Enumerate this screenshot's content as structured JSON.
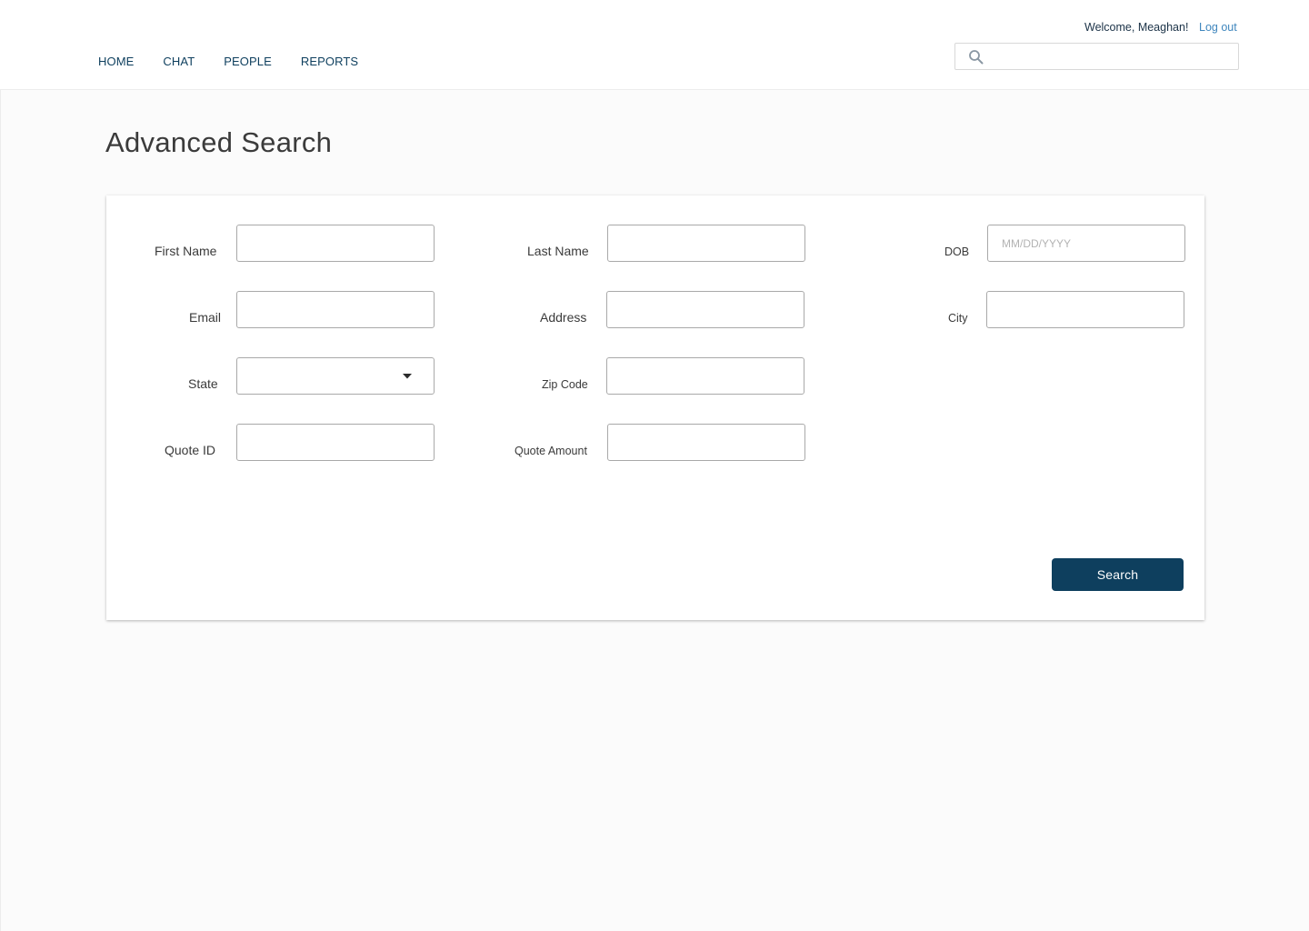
{
  "header": {
    "nav": [
      {
        "label": "HOME"
      },
      {
        "label": "CHAT"
      },
      {
        "label": "PEOPLE"
      },
      {
        "label": "REPORTS"
      }
    ],
    "welcome_text": "Welcome, Meaghan!",
    "logout_label": "Log out",
    "search": {
      "value": "",
      "placeholder": "",
      "icon": "search-icon"
    }
  },
  "page": {
    "title": "Advanced Search"
  },
  "form": {
    "first_name": {
      "label": "First Name",
      "value": ""
    },
    "last_name": {
      "label": "Last Name",
      "value": ""
    },
    "dob": {
      "label": "DOB",
      "value": "",
      "placeholder": "MM/DD/YYYY"
    },
    "email": {
      "label": "Email",
      "value": ""
    },
    "address": {
      "label": "Address",
      "value": ""
    },
    "city": {
      "label": "City",
      "value": ""
    },
    "state": {
      "label": "State",
      "selected": "",
      "icon": "chevron-down-icon"
    },
    "zip_code": {
      "label": "Zip Code",
      "value": ""
    },
    "quote_id": {
      "label": "Quote ID",
      "value": ""
    },
    "quote_amount": {
      "label": "Quote Amount",
      "value": ""
    },
    "submit_label": "Search"
  },
  "colors": {
    "primary": "#0e3f5e",
    "link": "#3f86bd",
    "background": "#fbfbfb",
    "input_border": "#a9a9a9"
  }
}
